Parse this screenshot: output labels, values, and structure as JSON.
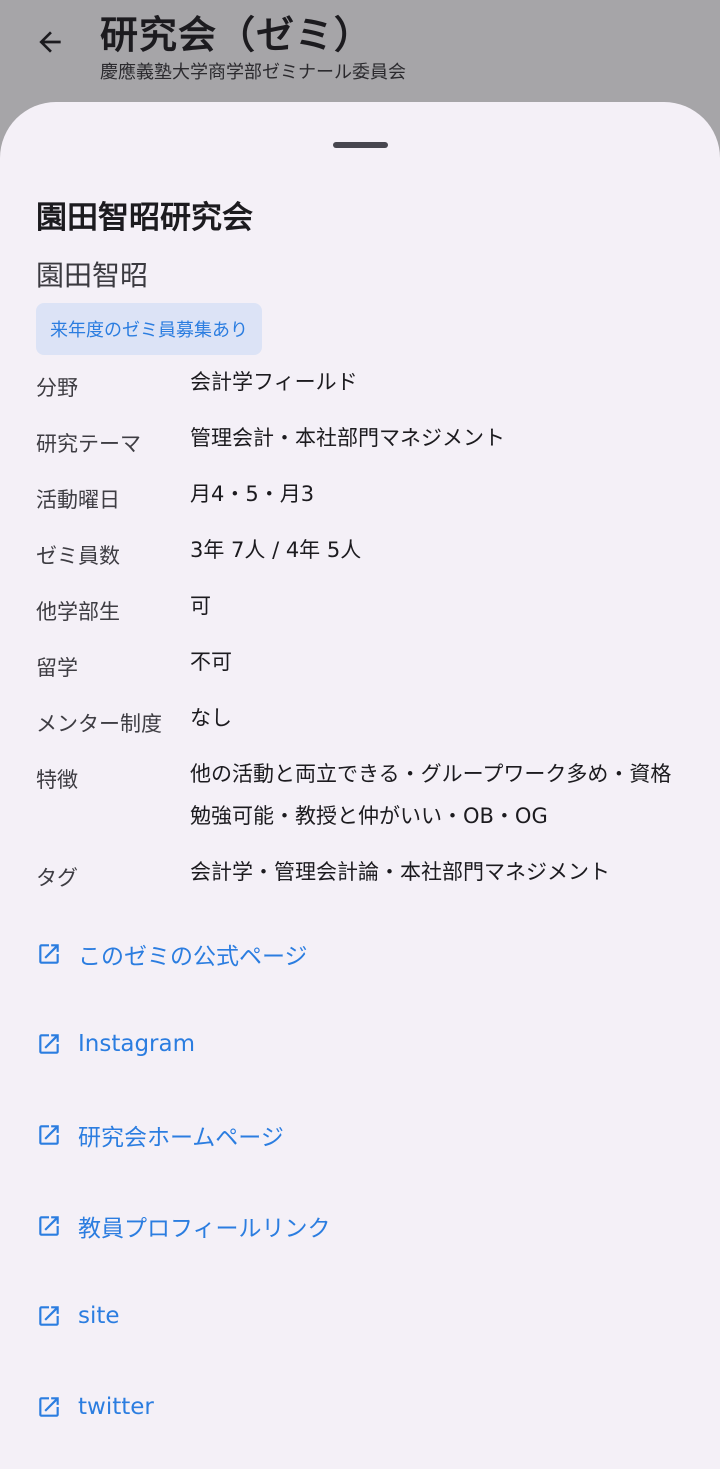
{
  "appbar": {
    "title": "研究会（ゼミ）",
    "subtitle": "慶應義塾大学商学部ゼミナール委員会",
    "back_icon": "arrow-back-icon"
  },
  "seminar": {
    "name": "園田智昭研究会",
    "professor": "園田智昭",
    "recruit_chip": "来年度のゼミ員募集あり"
  },
  "details": [
    {
      "key": "分野",
      "value": "会計学フィールド"
    },
    {
      "key": "研究テーマ",
      "value": "管理会計・本社部門マネジメント"
    },
    {
      "key": "活動曜日",
      "value": "月4・5・月3"
    },
    {
      "key": "ゼミ員数",
      "value": "3年 7人 / 4年 5人"
    },
    {
      "key": "他学部生",
      "value": "可"
    },
    {
      "key": "留学",
      "value": "不可"
    },
    {
      "key": "メンター制度",
      "value": "なし"
    },
    {
      "key": "特徴",
      "value": "他の活動と両立できる・グループワーク多め・資格勉強可能・教授と仲がいい・OB・OG"
    },
    {
      "key": "タグ",
      "value": "会計学・管理会計論・本社部門マネジメント"
    }
  ],
  "links": [
    {
      "label": "このゼミの公式ページ",
      "icon": "open-in-new-icon"
    },
    {
      "label": "Instagram",
      "icon": "open-in-new-icon"
    },
    {
      "label": "研究会ホームページ",
      "icon": "open-in-new-icon"
    },
    {
      "label": "教員プロフィールリンク",
      "icon": "open-in-new-icon"
    },
    {
      "label": "site",
      "icon": "open-in-new-icon"
    },
    {
      "label": "twitter",
      "icon": "open-in-new-icon"
    }
  ],
  "colors": {
    "scrim": "#a6a5a8",
    "sheet": "#f4f0f7",
    "accent": "#2b7de0",
    "chip_bg": "#dce3f6"
  }
}
